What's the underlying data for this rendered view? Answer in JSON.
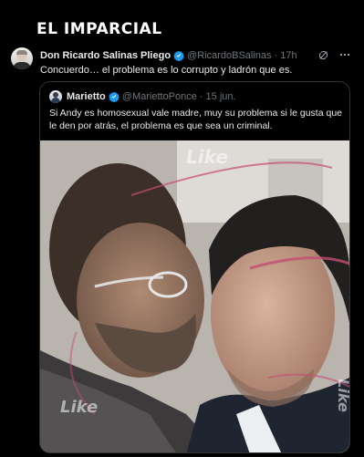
{
  "masthead": {
    "title": "EL IMPARCIAL"
  },
  "tweet": {
    "author_name": "Don Ricardo Salinas Pliego",
    "author_handle": "@RicardoBSalinas",
    "separator": "·",
    "time": "17h",
    "text": "Concuerdo… el problema es lo corrupto y ladrón que es.",
    "icons": [
      "verified-badge-icon",
      "grok-icon",
      "more-icon"
    ]
  },
  "quote": {
    "author_name": "Marietto",
    "author_handle": "@MariettoPonce",
    "separator": "·",
    "time": "15 jun.",
    "text": "Si Andy es homosexual vale madre, muy su problema si le gusta que le den por atrás, el problema es que sea un criminal.",
    "media": {
      "watermarks": [
        "Like",
        "Like",
        "Like"
      ]
    }
  },
  "colors": {
    "background": "#000000",
    "text": "#e7e9ea",
    "muted": "#71767b",
    "border": "#2f3336",
    "verified": "#1d9bf0"
  }
}
